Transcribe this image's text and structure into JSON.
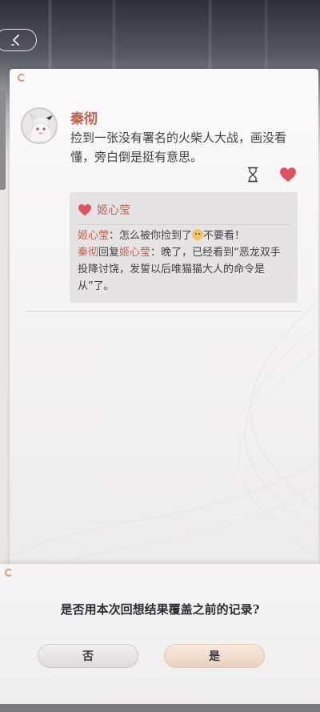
{
  "post": {
    "author": "秦彻",
    "text": "捡到一张没有署名的火柴人大战，画没看懂，旁白倒是挺有意思。"
  },
  "comments": {
    "liker_name": "姬心莹",
    "comment1": {
      "name": "姬心莹",
      "sep": "：",
      "text_before_emoji": "怎么被你捡到了",
      "text_after_emoji": "不要看！"
    },
    "comment2": {
      "name": "秦彻",
      "reply_word": "回复",
      "target": "姬心莹",
      "sep": "：",
      "text": "晚了，已经看到“恶龙双手投降讨饶，发誓以后唯猫猫大人的命令是从”了。"
    }
  },
  "dialog": {
    "question": "是否用本次回想结果覆盖之前的记录?",
    "no_label": "否",
    "yes_label": "是"
  },
  "colors": {
    "accent": "#c2624c",
    "like": "#e0525f"
  },
  "icons": [
    "back-arrow-icon",
    "hourglass-icon",
    "heart-icon",
    "brand-logo-icon"
  ]
}
